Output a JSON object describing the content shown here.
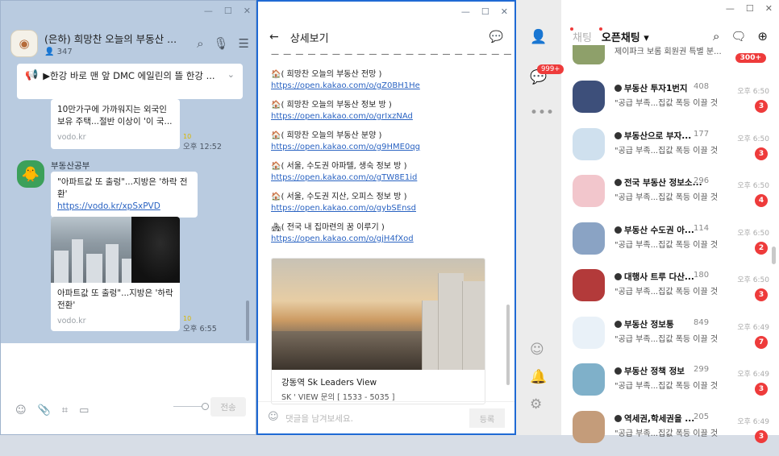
{
  "chat": {
    "title": "(은하) 희망찬 오늘의 부동산 ...",
    "member_count": "347",
    "notice": "▶한강 바로 맨 앞 DMC 에일린의 뜰 한강 ...",
    "card1_text": "10만가구에 가까워지는 외국인 보유 주택...절반 이상이 '이 국...",
    "card1_source": "vodo.kr",
    "card1_time": "오후 12:52",
    "card1_unread": "10",
    "sender": "부동산공부",
    "msg_text": "\"아파트값 또 출렁\"...지방은 '하락 전환'",
    "msg_link": "https://vodo.kr/xpSxPVD",
    "card2_text": "아파트값 또 출렁\"...지방은 '하락 전환'",
    "card2_source": "vodo.kr",
    "card2_time": "오후 6:55",
    "card2_unread": "10",
    "send_label": "전송",
    "icons": [
      "search-icon",
      "mic-icon",
      "menu-icon",
      "megaphone-icon",
      "emoji-icon",
      "attach-icon",
      "crop-icon",
      "chat-capture-icon"
    ]
  },
  "detail": {
    "title": "상세보기",
    "dashes": "— — — — — — — — — — — — — — — — — — — — — — — — — —",
    "entries": [
      {
        "heading": "( 희망찬 오늘의 부동산 전망 )",
        "link": "https://open.kakao.com/o/gZ0BH1He"
      },
      {
        "heading": "( 희망찬 오늘의 부동산 정보 방 )",
        "link": "https://open.kakao.com/o/grIxzNAd"
      },
      {
        "heading": "( 희망찬 오늘의 부동산 분양 )",
        "link": "https://open.kakao.com/o/g9HME0qg"
      },
      {
        "heading": "( 서울, 수도권 아파텔, 생숙 정보 방 )",
        "link": "https://open.kakao.com/o/gTW8E1id"
      },
      {
        "heading": "( 서울, 수도권 지산, 오피스 정보 방 )",
        "link": "https://open.kakao.com/o/gybSEnsd"
      },
      {
        "heading": "( 전국 내 집마련의 꿈 이루기 )",
        "link": "https://open.kakao.com/o/gjH4fXod"
      }
    ],
    "card_title": "강동역  Sk Leaders  View",
    "card_sub": "SK ' VIEW 문의 [ 1533 - 5035 ]",
    "input_placeholder": "댓글을 남겨보세요.",
    "register_label": "등록"
  },
  "list": {
    "rail_badge": "999+",
    "tab_chat": "채팅",
    "tab_open": "오픈채팅 ▾",
    "first_row_text": "제이파크 보롬 회원권 특별 분...",
    "first_row_badge": "300+",
    "rows": [
      {
        "name": "부동산 투자1번지",
        "count": "408",
        "preview": "\"공급 부족...집값 폭등 이끌 것",
        "time": "오후 6:50",
        "badge": "3",
        "color": "#3d4f7a"
      },
      {
        "name": "부동산으로 부자...",
        "count": "177",
        "preview": "\"공급 부족...집값 폭등 이끌 것",
        "time": "오후 6:50",
        "badge": "3",
        "color": "#cfe0ee"
      },
      {
        "name": "전국 부동산 정보소...",
        "count": "296",
        "preview": "\"공급 부족...집값 폭등 이끌 것",
        "time": "오후 6:50",
        "badge": "4",
        "color": "#f2c6cc"
      },
      {
        "name": "부동산 수도권 아...",
        "count": "114",
        "preview": "\"공급 부족...집값 폭등 이끌 것",
        "time": "오후 6:50",
        "badge": "2",
        "color": "#8aa3c4"
      },
      {
        "name": "대행사 트루 다산...",
        "count": "180",
        "preview": "\"공급 부족...집값 폭등 이끌 것",
        "time": "오후 6:50",
        "badge": "3",
        "color": "#b33a3a"
      },
      {
        "name": "부동산 정보통",
        "count": "849",
        "preview": "\"공급 부족...집값 폭등 이끌 것",
        "time": "오후 6:49",
        "badge": "7",
        "color": "#e9f1f8"
      },
      {
        "name": "부동산 정책 정보",
        "count": "299",
        "preview": "\"공급 부족...집값 폭등 이끌 것",
        "time": "오후 6:49",
        "badge": "3",
        "color": "#7fb0c9"
      },
      {
        "name": "역세권,학세권을 ...",
        "count": "205",
        "preview": "\"공급 부족...집값 폭등 이끌 것",
        "time": "오후 6:49",
        "badge": "3",
        "color": "#c49c7a"
      }
    ],
    "icons": [
      "profile-icon",
      "chat-icon",
      "more-icon",
      "emoji-icon",
      "bell-icon",
      "settings-icon",
      "search-icon",
      "new-chat-icon",
      "add-chat-icon"
    ]
  }
}
